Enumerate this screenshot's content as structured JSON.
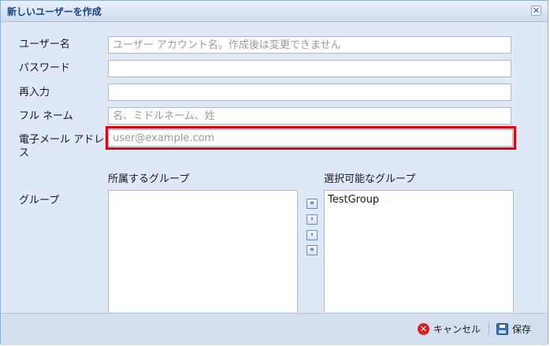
{
  "dialog": {
    "title": "新しいユーザーを作成",
    "close_icon": "close-icon"
  },
  "form": {
    "username": {
      "label": "ユーザー名",
      "value": "",
      "placeholder": "ユーザー アカウント名。作成後は変更できません"
    },
    "password": {
      "label": "パスワード",
      "value": "",
      "placeholder": ""
    },
    "reenter": {
      "label": "再入力",
      "value": "",
      "placeholder": ""
    },
    "fullname": {
      "label": "フル ネーム",
      "value": "",
      "placeholder": "名、ミドルネーム、姓"
    },
    "email": {
      "label": "電子メール アドレス",
      "value": "",
      "placeholder": "user@example.com"
    },
    "groups": {
      "label": "グループ",
      "member_header": "所属するグループ",
      "available_header": "選択可能なグループ",
      "member_items": [],
      "available_items": [
        "TestGroup"
      ],
      "mover_icons": [
        "double-arrow-right-icon",
        "arrow-right-icon",
        "arrow-left-icon",
        "double-arrow-left-icon"
      ]
    }
  },
  "toolbar": {
    "cancel_label": "キャンセル",
    "save_label": "保存",
    "cancel_icon": "cancel-icon",
    "save_icon": "save-icon"
  },
  "colors": {
    "highlight": "#e3000f",
    "title_text": "#15428b",
    "dialog_bg": "#dfe8f6"
  }
}
